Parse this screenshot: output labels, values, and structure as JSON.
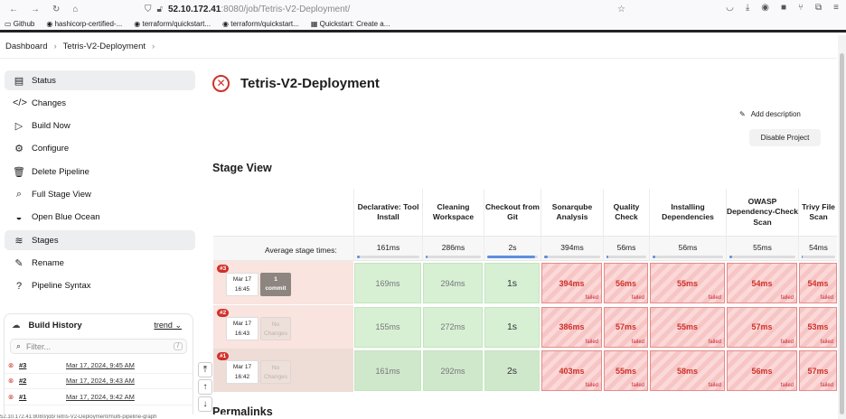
{
  "browser": {
    "url_host": "52.10.172.41",
    "url_path": ":8080/job/Tetris-V2-Deployment/",
    "bookmarks": [
      "Github",
      "hashicorp-certified-...",
      "terraform/quickstart...",
      "terraform/quickstart...",
      "Quickstart: Create a..."
    ]
  },
  "breadcrumb": {
    "dashboard": "Dashboard",
    "job": "Tetris-V2-Deployment"
  },
  "sidebar": {
    "items": [
      {
        "label": "Status",
        "icon": "document-icon",
        "glyph": "▤"
      },
      {
        "label": "Changes",
        "icon": "code-icon",
        "glyph": "</>"
      },
      {
        "label": "Build Now",
        "icon": "play-icon",
        "glyph": "▷"
      },
      {
        "label": "Configure",
        "icon": "gear-icon",
        "glyph": "⚙"
      },
      {
        "label": "Delete Pipeline",
        "icon": "trash-icon",
        "glyph": "🗑"
      },
      {
        "label": "Full Stage View",
        "icon": "search-icon",
        "glyph": "⌕"
      },
      {
        "label": "Open Blue Ocean",
        "icon": "blue-ocean-icon",
        "glyph": "◒"
      },
      {
        "label": "Stages",
        "icon": "layers-icon",
        "glyph": "≋"
      },
      {
        "label": "Rename",
        "icon": "pencil-icon",
        "glyph": "✎"
      },
      {
        "label": "Pipeline Syntax",
        "icon": "help-icon",
        "glyph": "?"
      }
    ]
  },
  "build_history": {
    "title": "Build History",
    "trend": "trend",
    "filter_placeholder": "Filter...",
    "filter_shortcut": "/",
    "builds": [
      {
        "num": "#3",
        "date": "Mar 17, 2024, 9:45 AM"
      },
      {
        "num": "#2",
        "date": "Mar 17, 2024, 9:43 AM"
      },
      {
        "num": "#1",
        "date": "Mar 17, 2024, 9:42 AM"
      }
    ]
  },
  "main": {
    "title": "Tetris-V2-Deployment",
    "add_description": "Add description",
    "disable_project": "Disable Project",
    "stage_view_title": "Stage View",
    "avg_label": "Average stage times:",
    "permalinks": "Permalinks"
  },
  "stages": [
    {
      "name": "Declarative: Tool Install",
      "avg": "161ms",
      "fill": 0.02
    },
    {
      "name": "Cleaning Workspace",
      "avg": "286ms",
      "fill": 0.04
    },
    {
      "name": "Checkout from Git",
      "avg": "2s",
      "fill": 0.95
    },
    {
      "name": "Sonarqube Analysis",
      "avg": "394ms",
      "fill": 0.06
    },
    {
      "name": "Quality Check",
      "avg": "56ms",
      "fill": 0.01
    },
    {
      "name": "Installing Dependencies",
      "avg": "56ms",
      "fill": 0.01
    },
    {
      "name": "OWASP Dependency-Check Scan",
      "avg": "55ms",
      "fill": 0.01
    },
    {
      "name": "Trivy File Scan",
      "avg": "54ms",
      "fill": 0.01
    }
  ],
  "runs": [
    {
      "num": "#3",
      "month": "Mar 17",
      "time": "16:45",
      "changes": "1 commit",
      "has_commit": true,
      "cells": [
        {
          "v": "169ms",
          "s": "ok"
        },
        {
          "v": "294ms",
          "s": "ok"
        },
        {
          "v": "1s",
          "s": "ok"
        },
        {
          "v": "394ms",
          "s": "fail"
        },
        {
          "v": "56ms",
          "s": "fail"
        },
        {
          "v": "55ms",
          "s": "fail"
        },
        {
          "v": "54ms",
          "s": "fail"
        },
        {
          "v": "54ms",
          "s": "fail"
        }
      ]
    },
    {
      "num": "#2",
      "month": "Mar 17",
      "time": "16:43",
      "changes": "No Changes",
      "has_commit": false,
      "cells": [
        {
          "v": "155ms",
          "s": "ok"
        },
        {
          "v": "272ms",
          "s": "ok"
        },
        {
          "v": "1s",
          "s": "ok"
        },
        {
          "v": "386ms",
          "s": "fail"
        },
        {
          "v": "57ms",
          "s": "fail"
        },
        {
          "v": "55ms",
          "s": "fail"
        },
        {
          "v": "57ms",
          "s": "fail"
        },
        {
          "v": "53ms",
          "s": "fail"
        }
      ]
    },
    {
      "num": "#1",
      "month": "Mar 17",
      "time": "16:42",
      "changes": "No Changes",
      "has_commit": false,
      "cells": [
        {
          "v": "161ms",
          "s": "ok"
        },
        {
          "v": "292ms",
          "s": "ok"
        },
        {
          "v": "2s",
          "s": "ok"
        },
        {
          "v": "403ms",
          "s": "fail"
        },
        {
          "v": "55ms",
          "s": "fail"
        },
        {
          "v": "58ms",
          "s": "fail"
        },
        {
          "v": "56ms",
          "s": "fail"
        },
        {
          "v": "57ms",
          "s": "fail"
        }
      ]
    }
  ],
  "failed_label": "failed",
  "status_bar": "52.10.172.41:8080/job/Tetris-V2-Deployment/multi-pipeline-graph"
}
